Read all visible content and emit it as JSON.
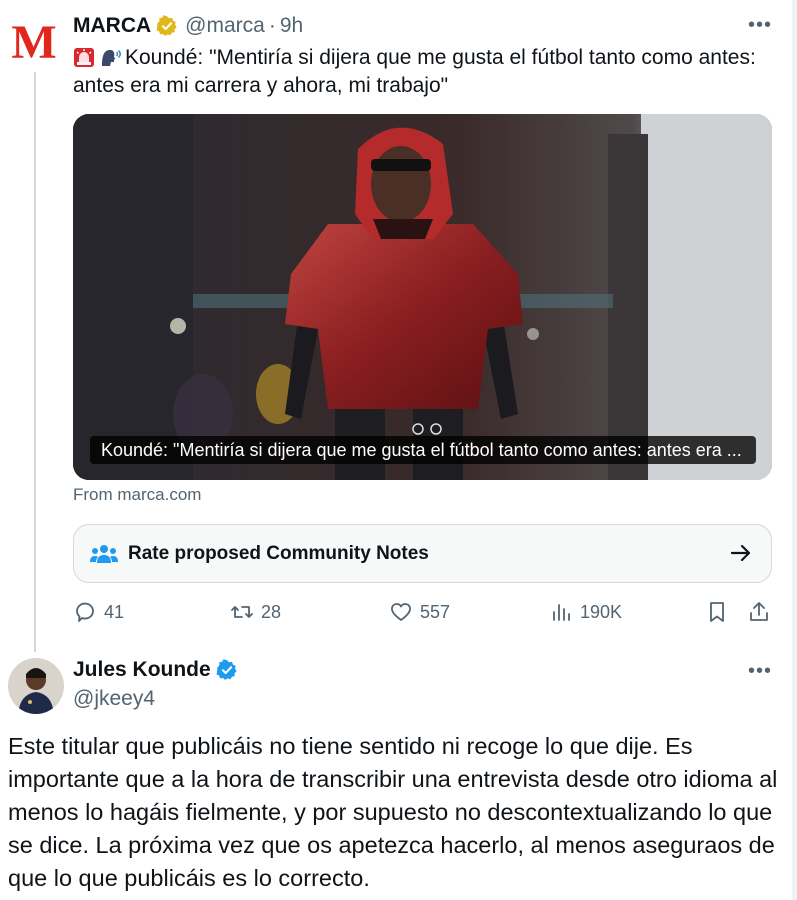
{
  "tweet1": {
    "author_name": "MARCA",
    "logo_letter": "M",
    "handle": "@marca",
    "separator": "·",
    "time": "9h",
    "more": "•••",
    "emojis": [
      "police-light-icon",
      "speaking-head-icon"
    ],
    "text": "Koundé: \"Mentiría si dijera que me gusta el fútbol tanto como antes: antes era mi carrera y ahora, mi trabajo\"",
    "media_caption": "Koundé: \"Mentiría si dijera que me gusta el fútbol tanto como antes: antes era ...",
    "source": "From marca.com",
    "community_notes_label": "Rate proposed Community Notes",
    "stats": {
      "replies": "41",
      "retweets": "28",
      "likes": "557",
      "views": "190K"
    }
  },
  "tweet2": {
    "author_name": "Jules Kounde",
    "handle": "@jkeey4",
    "more": "•••",
    "text": "Este titular que publicáis no tiene sentido ni recoge lo que dije. Es importante que a la hora de transcribir una entrevista desde otro idioma al menos lo hagáis fielmente, y por supuesto no descontextualizando lo que se dice. La próxima vez que os apetezca hacerlo, al menos aseguraos de que lo que publicáis es lo correcto."
  },
  "colors": {
    "text": "#0f1419",
    "muted": "#536471",
    "marca_red": "#e1261c",
    "gold_badge": "#e2b719",
    "blue_badge": "#1d9bf0",
    "border": "#cfd9de"
  }
}
